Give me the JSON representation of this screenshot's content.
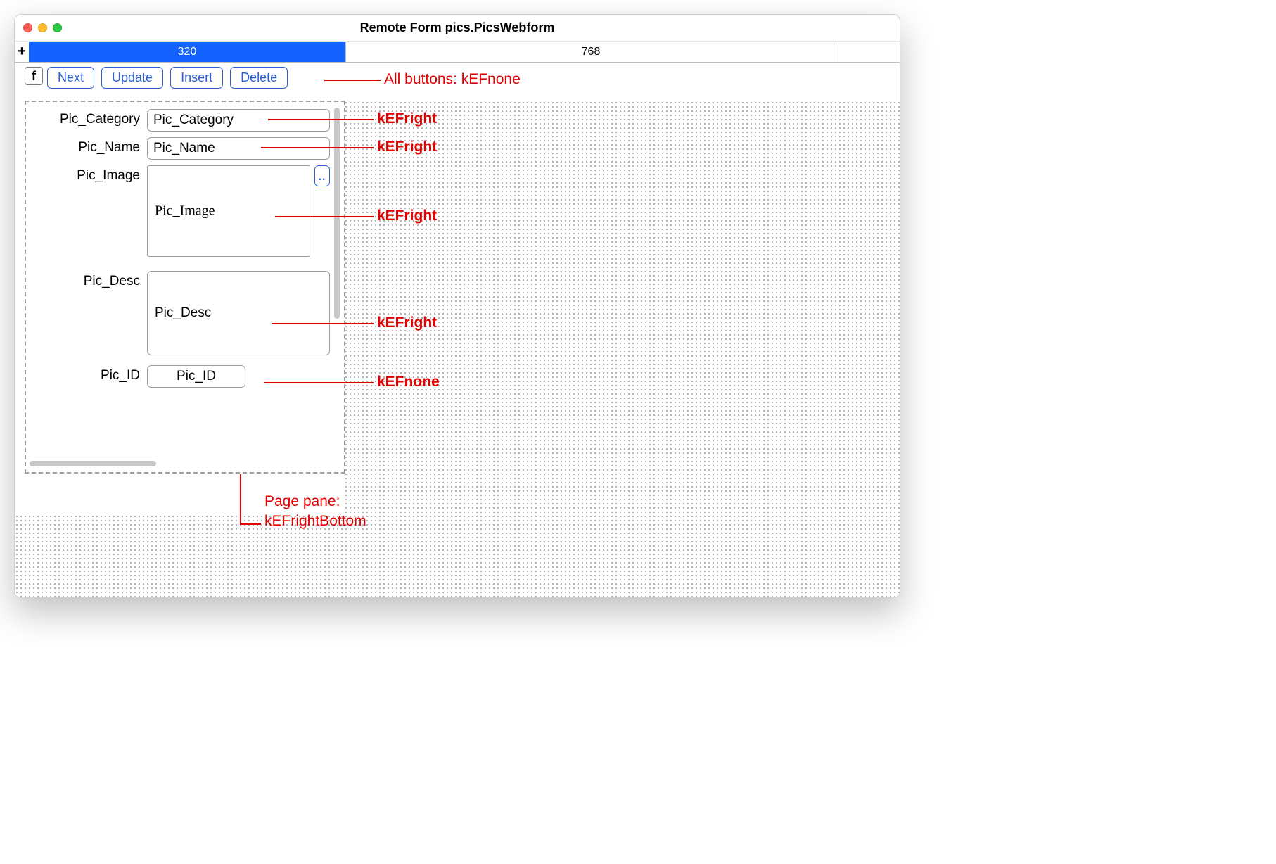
{
  "window": {
    "title": "Remote Form pics.PicsWebform"
  },
  "breakpoints": {
    "plus": "+",
    "active": "320",
    "inactive": "768"
  },
  "badge": "f",
  "buttons": {
    "next": "Next",
    "update": "Update",
    "insert": "Insert",
    "delete": "Delete"
  },
  "labels": {
    "pic_category": "Pic_Category",
    "pic_name": "Pic_Name",
    "pic_image": "Pic_Image",
    "pic_desc": "Pic_Desc",
    "pic_id": "Pic_ID"
  },
  "fields": {
    "pic_category": "Pic_Category",
    "pic_name": "Pic_Name",
    "pic_image": "Pic_Image",
    "pic_desc": "Pic_Desc",
    "pic_id": "Pic_ID",
    "ellipsis": ".."
  },
  "annotations": {
    "buttons": "All buttons: kEFnone",
    "pic_category": "kEFright",
    "pic_name": "kEFright",
    "pic_image": "kEFright",
    "pic_desc": "kEFright",
    "pic_id": "kEFnone",
    "page_pane_1": "Page pane:",
    "page_pane_2": "kEFrightBottom"
  }
}
